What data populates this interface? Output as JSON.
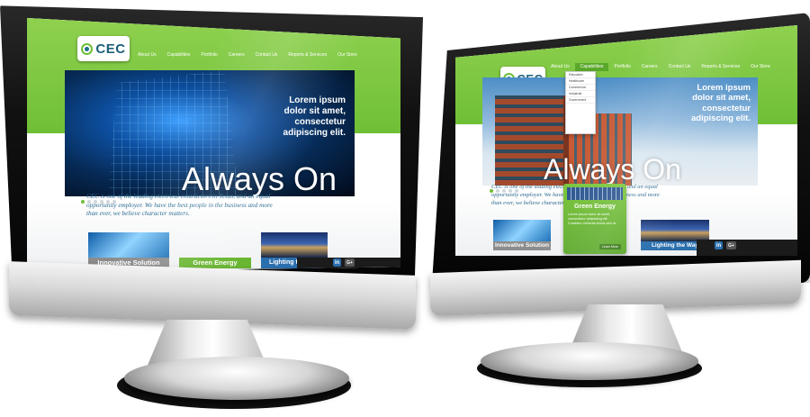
{
  "brand": {
    "logo_text": "CEC",
    "accent": "#6fbf36",
    "blue": "#2a6fae"
  },
  "nav": {
    "items": [
      "About Us",
      "Capabilities",
      "Portfolio",
      "Careers",
      "Contact Us",
      "Reports & Services",
      "Our Store"
    ]
  },
  "hero": {
    "tagline": "Lorem ipsum dolor sit amet, consectetur adipiscing elit.",
    "headline": "Always On"
  },
  "intro": "CEC is one of the leading electrical contractors in Texas, and an equal opportunity employer. We have the best people in the business and more than ever, we believe character matters.",
  "intro_right": "CEC is one of the leading electrical contractors in Texas, and an equal opportunity employer. We have the best people in the business and more than ever, we believe character matters.",
  "tiles": [
    {
      "label": "Innovative Solution",
      "icon": "glass-building-image"
    },
    {
      "label": "Green Energy",
      "icon": "solar-panel-image"
    },
    {
      "label": "Lighting the Way",
      "icon": "night-skyline-image"
    }
  ],
  "social": {
    "linkedin": "in",
    "google": "G+"
  },
  "dropdown": [
    "Education",
    "Healthcare",
    "Commercial",
    "Industrial",
    "Government"
  ],
  "popup": {
    "title": "Green Energy",
    "text": "Lorem ipsum dolor sit amet, consectetur adipiscing elit. Curabitur vehicula lectus sed ut.",
    "button": "Learn More"
  }
}
